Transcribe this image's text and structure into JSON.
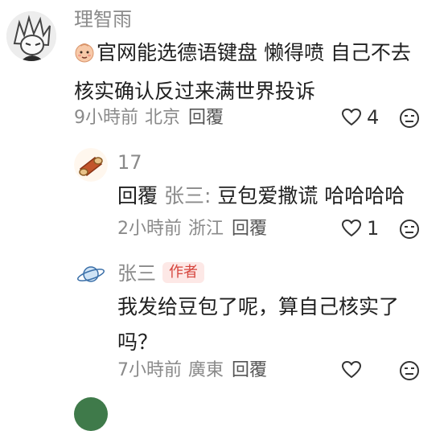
{
  "comments": [
    {
      "username": "理智雨",
      "text_line1": "官网能选德语键盘 懒得喷 自己不去",
      "text_line2": "核实确认反过来满世界投诉",
      "time": "9小時前",
      "location": "北京",
      "reply_label": "回覆",
      "likes": "4"
    },
    {
      "username": "17",
      "reply_prefix": "回覆",
      "mention": "张三:",
      "text": " 豆包爱撒谎 哈哈哈哈",
      "time": "2小時前",
      "location": "浙江",
      "reply_label": "回覆",
      "likes": "1"
    },
    {
      "username": "张三",
      "badge": "作者",
      "text_line1": "我发给豆包了呢，算自己核实了",
      "text_line2": "吗？",
      "time": "7小時前",
      "location": "廣東",
      "reply_label": "回覆",
      "likes": ""
    }
  ],
  "icons": {
    "like": "heart-outline-icon",
    "dislike": "meh-face-icon"
  }
}
